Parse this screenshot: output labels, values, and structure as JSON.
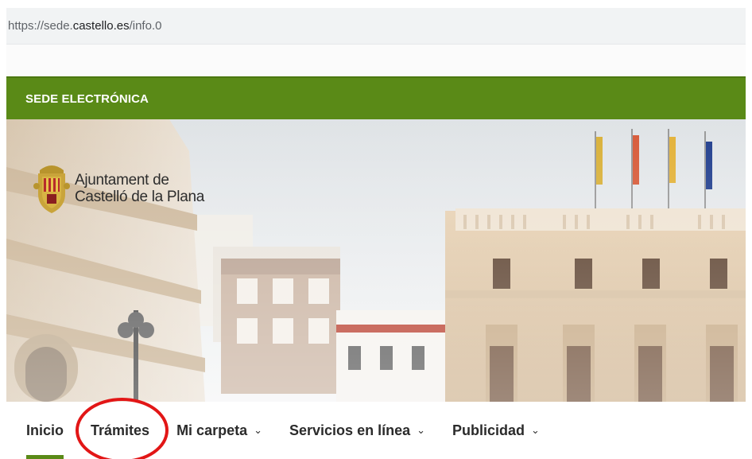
{
  "browser": {
    "url_prefix": "https://sede.",
    "url_host": "castello.es",
    "url_path": "/info.0"
  },
  "header": {
    "banner_label": "SEDE ELECTRÓNICA",
    "banner_color": "#5a8a17"
  },
  "hero": {
    "logo_line1": "Ajuntament de",
    "logo_line2": "Castelló de la Plana"
  },
  "nav": {
    "items": [
      {
        "label": "Inicio",
        "active": true
      },
      {
        "label": "Trámites",
        "active": false
      },
      {
        "label": "Mi carpeta",
        "has_dropdown": true
      },
      {
        "label": "Servicios en línea",
        "has_dropdown": true
      },
      {
        "label": "Publicidad",
        "has_dropdown": true
      }
    ],
    "chevron": "⌄",
    "highlight_color": "#e21616"
  }
}
